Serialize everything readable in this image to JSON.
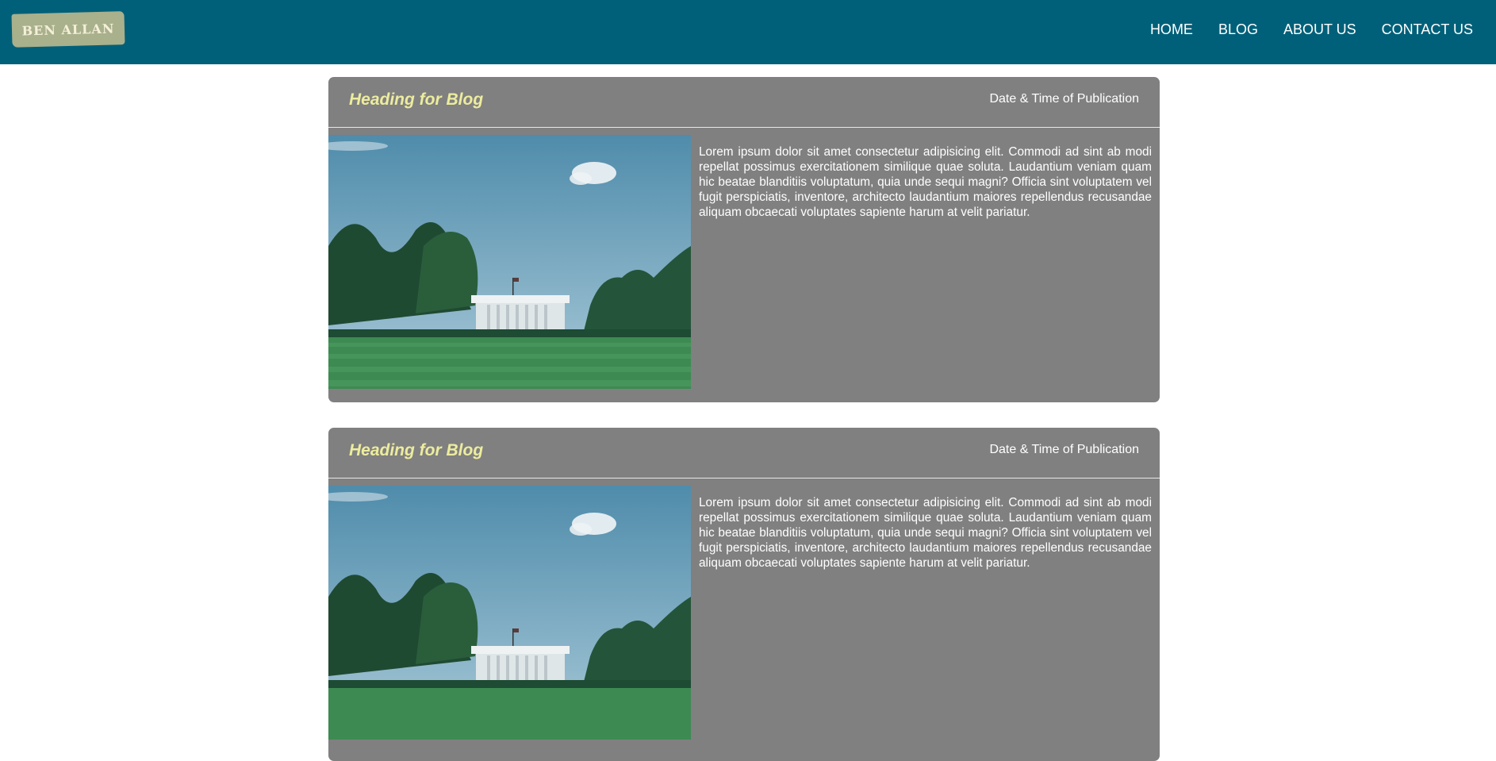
{
  "header": {
    "logo_text": "BEN ALLAN",
    "nav": [
      {
        "label": "HOME"
      },
      {
        "label": "BLOG"
      },
      {
        "label": "ABOUT US"
      },
      {
        "label": "CONTACT US"
      }
    ]
  },
  "posts": [
    {
      "title": "Heading for Blog",
      "date": "Date & Time of Publication",
      "body": "Lorem ipsum dolor sit amet consectetur adipisicing elit. Commodi ad sint ab modi repellat possimus exercitationem similique quae soluta. Laudantium veniam quam hic beatae blanditiis voluptatum, quia unde sequi magni? Officia sint voluptatem vel fugit perspiciatis, inventore, architecto laudantium maiores repellendus recusandae aliquam obcaecati voluptates sapiente harum at velit pariatur."
    },
    {
      "title": "Heading for Blog",
      "date": "Date & Time of Publication",
      "body": "Lorem ipsum dolor sit amet consectetur adipisicing elit. Commodi ad sint ab modi repellat possimus exercitationem similique quae soluta. Laudantium veniam quam hic beatae blanditiis voluptatum, quia unde sequi magni? Officia sint voluptatem vel fugit perspiciatis, inventore, architecto laudantium maiores repellendus recusandae aliquam obcaecati voluptates sapiente harum at velit pariatur."
    }
  ],
  "colors": {
    "navbar_bg": "#006079",
    "card_bg": "#808080",
    "title_color": "#ecec9e",
    "logo_bg": "#a9b08c"
  }
}
